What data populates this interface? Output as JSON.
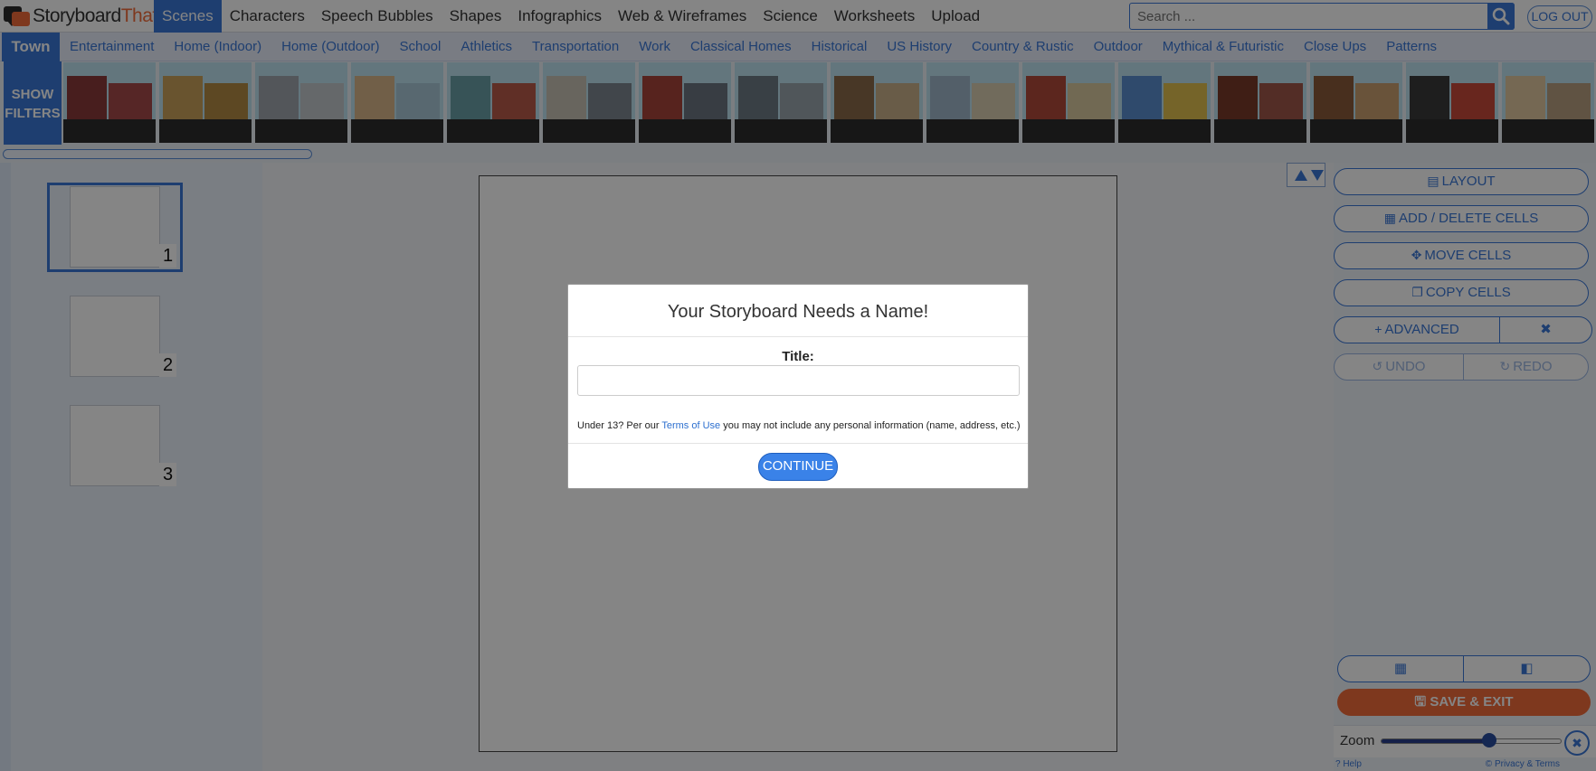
{
  "brand": {
    "part1": "Storyboard",
    "part2": "That"
  },
  "topnav": {
    "items": [
      {
        "label": "Scenes",
        "active": true
      },
      {
        "label": "Characters"
      },
      {
        "label": "Speech Bubbles"
      },
      {
        "label": "Shapes"
      },
      {
        "label": "Infographics"
      },
      {
        "label": "Web & Wireframes"
      },
      {
        "label": "Science"
      },
      {
        "label": "Worksheets"
      },
      {
        "label": "Upload"
      }
    ],
    "search_placeholder": "Search ...",
    "logout_label": "LOG OUT"
  },
  "categories": {
    "selected": "Town",
    "items": [
      "Entertainment",
      "Home (Indoor)",
      "Home (Outdoor)",
      "School",
      "Athletics",
      "Transportation",
      "Work",
      "Classical Homes",
      "Historical",
      "US History",
      "Country & Rustic",
      "Outdoor",
      "Mythical & Futuristic",
      "Close Ups",
      "Patterns"
    ]
  },
  "filters": {
    "line1": "SHOW",
    "line2": "FILTERS"
  },
  "cells": [
    {
      "number": "1"
    },
    {
      "number": "2"
    },
    {
      "number": "3"
    }
  ],
  "tools": {
    "layout": "LAYOUT",
    "add_delete": "ADD / DELETE CELLS",
    "move": "MOVE CELLS",
    "copy": "COPY CELLS",
    "advanced": "ADVANCED",
    "undo": "UNDO",
    "redo": "REDO",
    "save_exit": "SAVE & EXIT",
    "zoom_label": "Zoom",
    "zoom_level": 0.6,
    "help": "? Help",
    "privacy": "© Privacy & Terms"
  },
  "modal": {
    "title": "Your Storyboard Needs a Name!",
    "field_label": "Title:",
    "field_value": "",
    "note_before": "Under 13? Per our ",
    "note_link": "Terms of Use",
    "note_after": " you may not include any personal information (name, address, etc.)",
    "continue_label": "CONTINUE"
  },
  "colors": {
    "accent": "#3a77d6",
    "save": "#f26b3a",
    "logo_orange": "#f26b3a"
  }
}
